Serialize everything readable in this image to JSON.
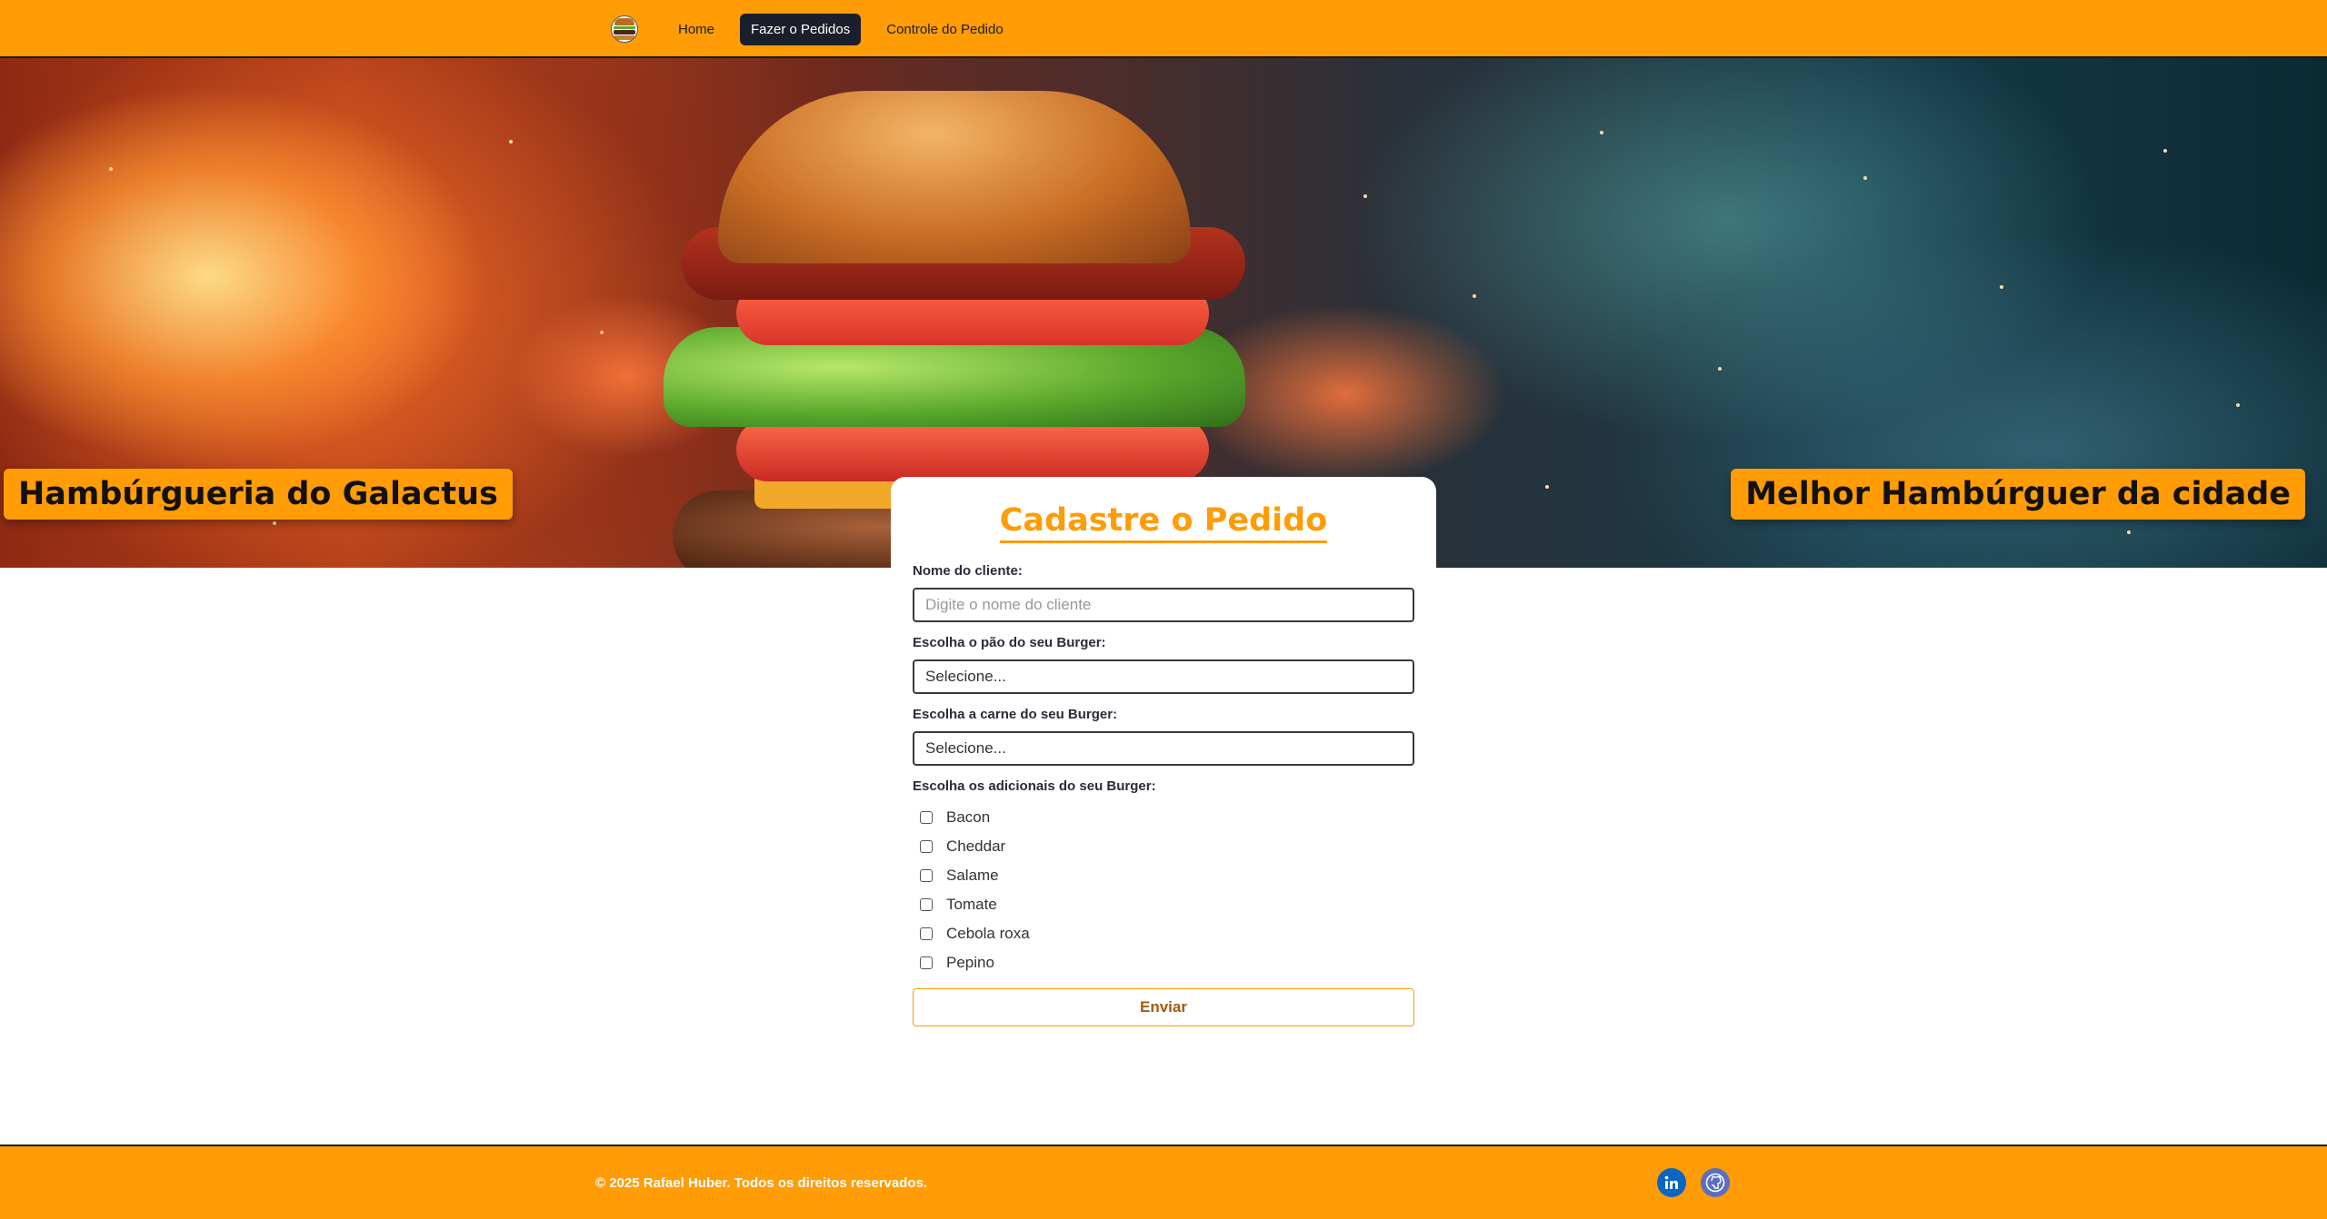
{
  "nav": {
    "logo_icon": "burger-icon",
    "links": [
      {
        "label": "Home",
        "active": false
      },
      {
        "label": "Fazer o Pedidos",
        "active": true
      },
      {
        "label": "Controle do Pedido",
        "active": false
      }
    ]
  },
  "hero": {
    "left_label": "Hambúrgueria do Galactus",
    "right_label": "Melhor Hambúrguer da cidade"
  },
  "form": {
    "title": "Cadastre o Pedido",
    "client_label": "Nome do cliente:",
    "client_placeholder": "Digite o nome do cliente",
    "bread_label": "Escolha o pão do seu Burger:",
    "bread_value": "Selecione...",
    "meat_label": "Escolha a carne do seu Burger:",
    "meat_value": "Selecione...",
    "extras_label": "Escolha os adicionais do seu Burger:",
    "extras": [
      "Bacon",
      "Cheddar",
      "Salame",
      "Tomate",
      "Cebola roxa",
      "Pepino"
    ],
    "submit_label": "Enviar"
  },
  "footer": {
    "copyright": "© 2025 Rafael Huber. Todos os direitos reservados.",
    "social": [
      "linkedin-icon",
      "github-icon"
    ]
  },
  "colors": {
    "accent": "#ff9c06",
    "nav_active": "#1b1f2b",
    "submit_text": "#a25b0a"
  }
}
